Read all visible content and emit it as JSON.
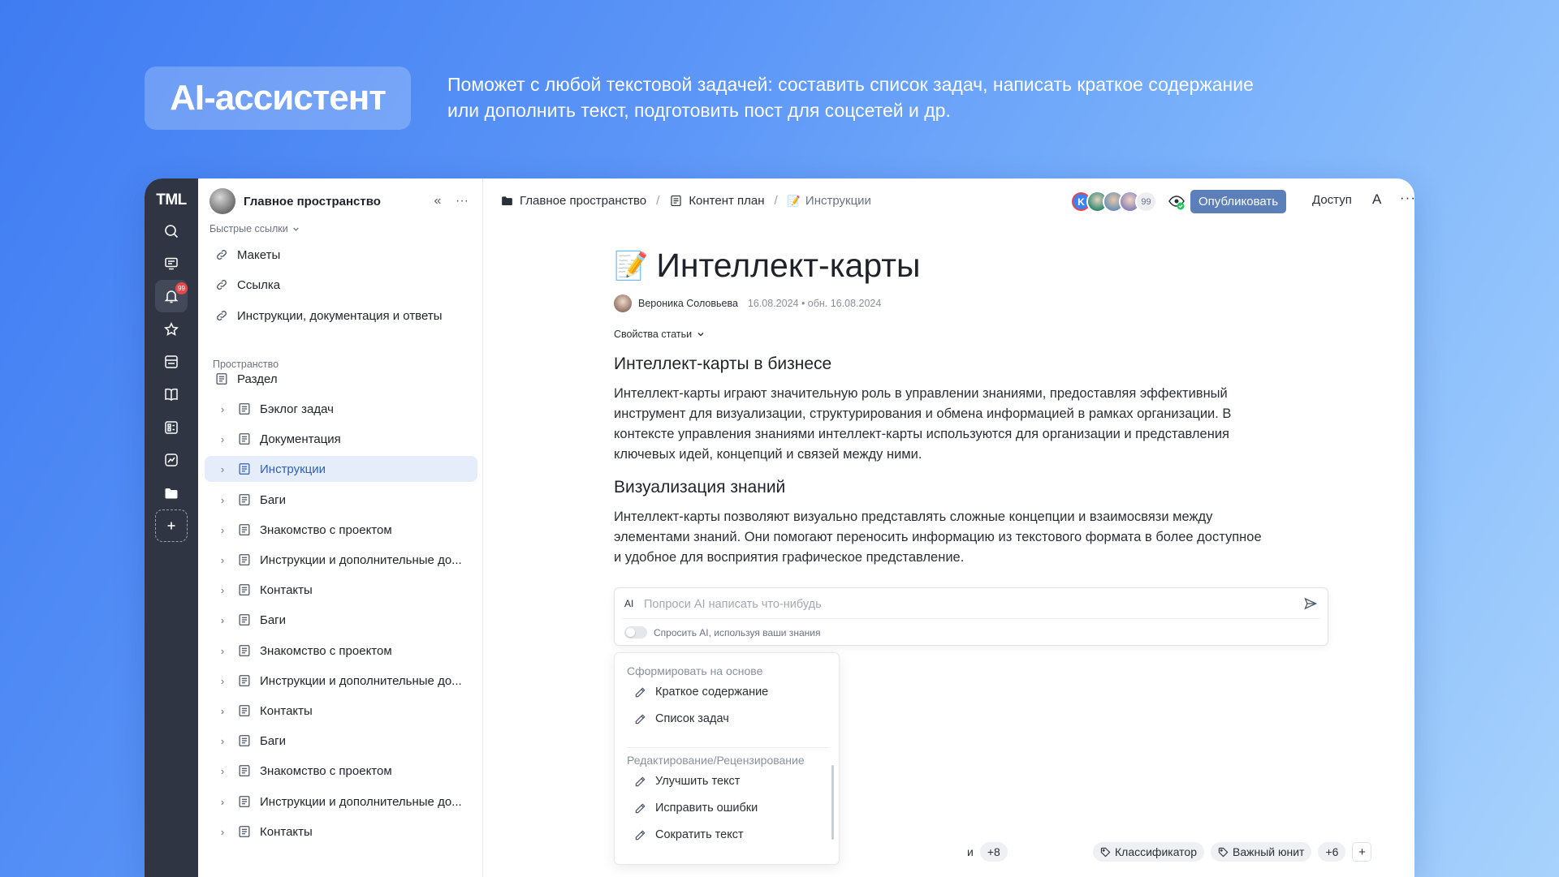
{
  "promo": {
    "title": "AI-ассистент",
    "desc_line1": "Поможет с любой текстовой задачей: составить список задач, написать краткое содержание",
    "desc_line2": "или дополнить текст, подготовить пост для соцсетей и др."
  },
  "rail": {
    "logo": "TML",
    "notifications_badge": "99"
  },
  "sidebar": {
    "workspace_name": "Главное пространство",
    "collapse_icon": "«",
    "more_icon": "···",
    "quick_links_label": "Быстрые ссылки",
    "quick_links": [
      {
        "label": "Макеты"
      },
      {
        "label": "Ссылка"
      },
      {
        "label": "Инструкции, документация и ответы"
      }
    ],
    "space_label": "Пространство",
    "items": [
      {
        "label": "Раздел"
      },
      {
        "label": "Бэклог задач"
      },
      {
        "label": "Документация"
      },
      {
        "label": "Инструкции"
      },
      {
        "label": "Баги"
      },
      {
        "label": "Знакомство с проектом"
      },
      {
        "label": "Инструкции и дополнительные до..."
      },
      {
        "label": "Контакты"
      },
      {
        "label": "Баги"
      },
      {
        "label": "Знакомство с проектом"
      },
      {
        "label": "Инструкции и дополнительные до..."
      },
      {
        "label": "Контакты"
      },
      {
        "label": "Баги"
      },
      {
        "label": "Знакомство с проектом"
      },
      {
        "label": "Инструкции и дополнительные до..."
      },
      {
        "label": "Контакты"
      }
    ]
  },
  "topbar": {
    "breadcrumbs": [
      "Главное пространство",
      "Контент план",
      "Инструкции"
    ],
    "avatar_k": "K",
    "avatars_more": "99",
    "publish_label": "Опубликовать",
    "access_label": "Доступ",
    "font_label": "A",
    "more_label": "···"
  },
  "document": {
    "emoji": "📝",
    "title": "Интеллект-карты",
    "author": "Вероника Соловьева",
    "dates": "16.08.2024 • обн. 16.08.2024",
    "props_label": "Свойства статьи",
    "heading1": "Интеллект-карты в бизнесе",
    "para1": "Интеллект-карты играют значительную роль в управлении знаниями, предоставляя эффективный инструмент для визуализации, структурирования и обмена информацией в рамках организации. В контексте управления знаниями интеллект-карты используются для организации и представления ключевых идей, концепций и связей между ними.",
    "heading2": "Визуализация знаний",
    "para2": "Интеллект-карты позволяют визуально представлять сложные концепции и взаимосвязи между элементами знаний. Они помогают переносить информацию из текстового формата в более доступное и удобное для восприятия графическое представление."
  },
  "ai": {
    "tag": "AI",
    "placeholder": "Попроси AI написать что-нибудь",
    "toggle_label": "Спросить AI, используя ваши знания",
    "menu": {
      "group1": "Сформировать на основе",
      "group1_items": [
        "Краткое содержание",
        "Список задач"
      ],
      "group2": "Редактирование/Рецензирование",
      "group2_items": [
        "Улучшить текст",
        "Исправить ошибки",
        "Сократить текст"
      ]
    }
  },
  "tags": {
    "left_partial": "и",
    "left_more": "+8",
    "items": [
      "Классификатор",
      "Важный юнит"
    ],
    "right_more": "+6",
    "add": "+"
  },
  "colors": {
    "accent": "#5b7fb8",
    "rail_bg": "#2f3542",
    "active_item_bg": "#e5edfb",
    "active_item_text": "#2d5fb9",
    "badge": "#e5484d"
  }
}
